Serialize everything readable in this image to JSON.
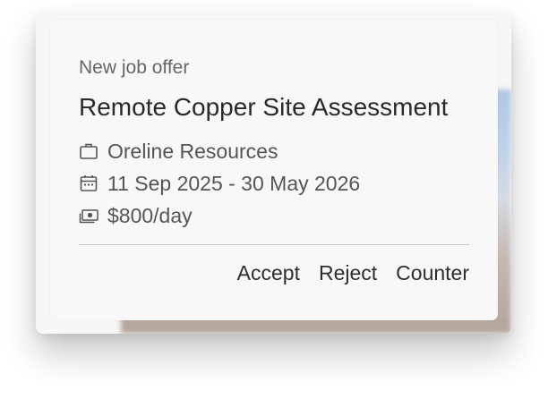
{
  "notification": {
    "eyebrow": "New job offer",
    "title": "Remote Copper Site Assessment",
    "company": {
      "icon": "briefcase-icon",
      "text": "Oreline Resources"
    },
    "dates": {
      "icon": "calendar-icon",
      "text": "11 Sep 2025 - 30 May 2026"
    },
    "pay": {
      "icon": "money-icon",
      "text": "$800/day"
    },
    "actions": {
      "accept": "Accept",
      "reject": "Reject",
      "counter": "Counter"
    }
  },
  "colors": {
    "card_background": "#f8f8f8",
    "title_text": "#2a2a2a",
    "secondary_text": "#666666",
    "divider": "#c9c9c9"
  }
}
